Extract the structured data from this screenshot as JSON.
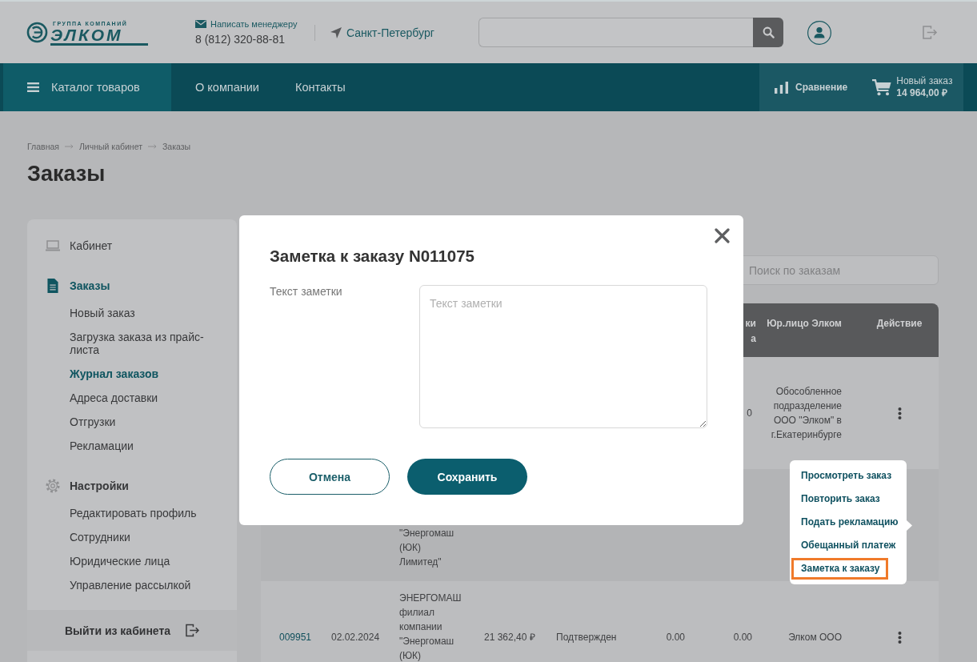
{
  "header": {
    "logo": {
      "tagline": "ГРУППА КОМПАНИЙ",
      "name": "ЭЛКОМ"
    },
    "contact": {
      "link": "Написать менеджеру",
      "phone": "8 (812) 320-88-81"
    },
    "city": "Санкт-Петербург"
  },
  "nav": {
    "items": [
      {
        "label": "Каталог товаров",
        "kind": "catalog"
      },
      {
        "label": "О компании",
        "kind": "link"
      },
      {
        "label": "Контакты",
        "kind": "link"
      }
    ],
    "compare": {
      "label": "Сравнение"
    },
    "cart": {
      "label": "Новый заказ",
      "total": "14 964,00 ₽"
    }
  },
  "breadcrumbs": [
    "Главная",
    "Личный кабинет",
    "Заказы"
  ],
  "page_title": "Заказы",
  "sidebar": {
    "sections": [
      {
        "label": "Кабинет",
        "selected": false
      },
      {
        "label": "Заказы",
        "selected": true,
        "children": [
          {
            "label": "Новый заказ",
            "selected": false
          },
          {
            "label": "Загрузка заказа из прайс-листа",
            "selected": false
          },
          {
            "label": "Журнал заказов",
            "selected": true
          },
          {
            "label": "Адреса доставки",
            "selected": false
          },
          {
            "label": "Отгрузки",
            "selected": false
          },
          {
            "label": "Рекламации",
            "selected": false
          }
        ]
      },
      {
        "label": "Настройки",
        "selected": false,
        "children": [
          {
            "label": "Редактировать профиль",
            "selected": false
          },
          {
            "label": "Сотрудники",
            "selected": false
          },
          {
            "label": "Юридические лица",
            "selected": false
          },
          {
            "label": "Управление рассылкой",
            "selected": false
          }
        ]
      }
    ],
    "logout": "Выйти из кабинета"
  },
  "orders": {
    "search": {
      "placeholder": "Поиск по заказам"
    },
    "table": {
      "header": {
        "column_7": "ки\nа",
        "column_8": "Юр.лицо Элком",
        "column_9": "Действие"
      },
      "rows": [
        {
          "column_7": "0",
          "column_8": "Обособленное подразделение ООО \"Элком\" в г.Екатеринбурге",
          "menu_open": false
        },
        {
          "column_3": "\"Энергомаш (ЮК) Лимитед\"",
          "menu_open": true
        },
        {
          "column_1": "009951",
          "column_2": "02.02.2024",
          "column_3": "ЭНЕРГОМАШ филиал компании \"Энергомаш (ЮК)",
          "column_4": "21 362,40 ₽",
          "column_5": "Подтвержден",
          "column_6": "0.00",
          "column_7": "0.00",
          "column_8": "Элком ООО",
          "menu_open": false
        }
      ]
    }
  },
  "modal": {
    "title": "Заметка к заказу N011075",
    "field_label": "Текст заметки",
    "textarea": {
      "placeholder": "Текст заметки"
    },
    "buttons": [
      {
        "label": "Отмена",
        "kind": "secondary"
      },
      {
        "label": "Сохранить",
        "kind": "primary"
      }
    ]
  },
  "action_menu": {
    "items": [
      {
        "label": "Просмотреть заказ",
        "selected": false
      },
      {
        "label": "Повторить заказ",
        "selected": false
      },
      {
        "label": "Подать рекламацию",
        "selected": false
      },
      {
        "label": "Обещанный платеж",
        "selected": false
      },
      {
        "label": "Заметка к заказу",
        "selected": true
      }
    ]
  }
}
